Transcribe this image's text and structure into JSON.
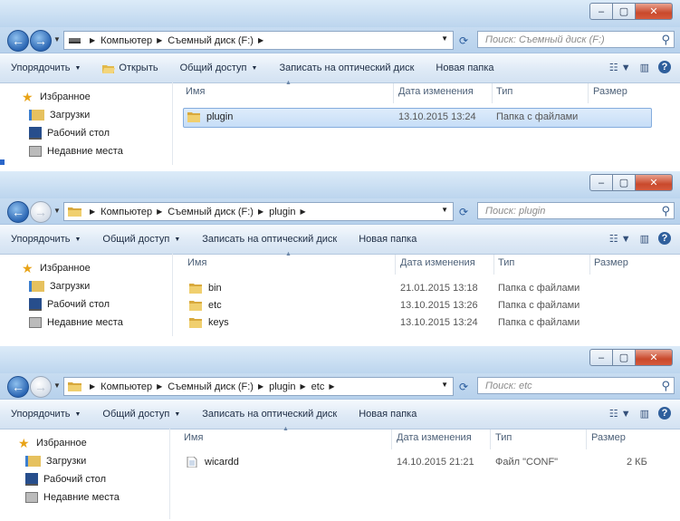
{
  "windows": [
    {
      "breadcrumb": [
        "Компьютер",
        "Съемный диск (F:)"
      ],
      "search_placeholder": "Поиск: Съемный диск (F:)",
      "toolbar": [
        "Упорядочить",
        "Открыть",
        "Общий доступ",
        "Записать на оптический диск",
        "Новая папка"
      ],
      "columns": [
        "Имя",
        "Дата изменения",
        "Тип",
        "Размер"
      ],
      "nav": [
        "Избранное",
        "Загрузки",
        "Рабочий стол",
        "Недавние места"
      ],
      "files": [
        {
          "name": "plugin",
          "date": "13.10.2015 13:24",
          "type": "Папка с файлами",
          "size": ""
        }
      ]
    },
    {
      "breadcrumb": [
        "Компьютер",
        "Съемный диск (F:)",
        "plugin"
      ],
      "search_placeholder": "Поиск: plugin",
      "toolbar": [
        "Упорядочить",
        "Общий доступ",
        "Записать на оптический диск",
        "Новая папка"
      ],
      "columns": [
        "Имя",
        "Дата изменения",
        "Тип",
        "Размер"
      ],
      "nav": [
        "Избранное",
        "Загрузки",
        "Рабочий стол",
        "Недавние места"
      ],
      "files": [
        {
          "name": "bin",
          "date": "21.01.2015 13:18",
          "type": "Папка с файлами",
          "size": ""
        },
        {
          "name": "etc",
          "date": "13.10.2015 13:26",
          "type": "Папка с файлами",
          "size": ""
        },
        {
          "name": "keys",
          "date": "13.10.2015 13:24",
          "type": "Папка с файлами",
          "size": ""
        }
      ]
    },
    {
      "breadcrumb": [
        "Компьютер",
        "Съемный диск (F:)",
        "plugin",
        "etc"
      ],
      "search_placeholder": "Поиск: etc",
      "toolbar": [
        "Упорядочить",
        "Общий доступ",
        "Записать на оптический диск",
        "Новая папка"
      ],
      "columns": [
        "Имя",
        "Дата изменения",
        "Тип",
        "Размер"
      ],
      "nav": [
        "Избранное",
        "Загрузки",
        "Рабочий стол",
        "Недавние места"
      ],
      "files": [
        {
          "name": "wicardd",
          "date": "14.10.2015 21:21",
          "type": "Файл \"CONF\"",
          "size": "2 КБ"
        }
      ]
    }
  ],
  "colors": {
    "accent": "#2c67b4",
    "selection": "#c6ddf7",
    "titlebar": "#c9def2"
  }
}
